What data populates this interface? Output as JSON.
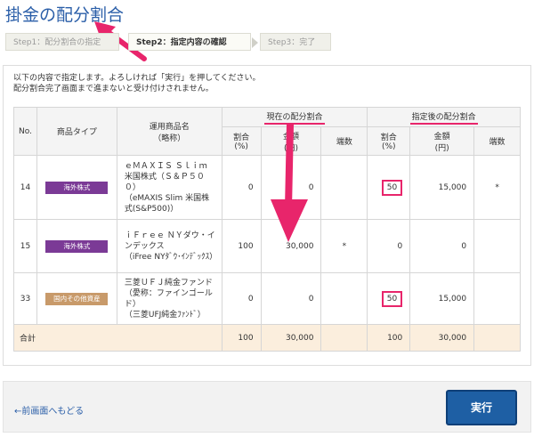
{
  "page": {
    "title": "掛金の配分割合"
  },
  "steps": [
    {
      "label": "Step1：配分割合の指定"
    },
    {
      "label": "Step2：指定内容の確認"
    },
    {
      "label": "Step3：完了"
    }
  ],
  "notice": {
    "line1": "以下の内容で指定します。よろしければ「実行」を押してください。",
    "line2": "配分割合完了画面まで進まないと受け付けされません。"
  },
  "table": {
    "headers": {
      "no": "No.",
      "type": "商品タイプ",
      "product": "運用商品名",
      "product_sub": "（略称）",
      "current_group": "現在の配分割合",
      "new_group": "指定後の配分割合",
      "ratio": "割合",
      "ratio_unit": "(%)",
      "amount": "金額",
      "amount_unit": "(円)",
      "fraction": "端数"
    },
    "rows": [
      {
        "no": "14",
        "type": "海外株式",
        "name1": "ｅＭＡＸＩＳ Ｓｌｉｍ 米国株式（Ｓ＆Ｐ５００）",
        "name2": "（eMAXIS Slim 米国株式(S&P500)）",
        "cur_ratio": "0",
        "cur_amount": "0",
        "cur_frac": "",
        "new_ratio": "50",
        "new_amount": "15,000",
        "new_frac": "*"
      },
      {
        "no": "15",
        "type": "海外株式",
        "name1": "ｉＦｒｅｅ ＮＹダウ・インデックス",
        "name2": "（iFree NYﾀﾞｳ･ｲﾝﾃﾞｯｸｽ）",
        "cur_ratio": "100",
        "cur_amount": "30,000",
        "cur_frac": "*",
        "new_ratio": "0",
        "new_amount": "0",
        "new_frac": ""
      },
      {
        "no": "33",
        "type": "国内その他資産",
        "name1": "三菱ＵＦＪ純金ファンド（愛称：ファインゴールド）",
        "name2": "（三菱UFJ純金ﾌｧﾝﾄﾞ）",
        "cur_ratio": "0",
        "cur_amount": "0",
        "cur_frac": "",
        "new_ratio": "50",
        "new_amount": "15,000",
        "new_frac": ""
      }
    ],
    "total": {
      "label": "合計",
      "cur_ratio": "100",
      "cur_amount": "30,000",
      "new_ratio": "100",
      "new_amount": "30,000"
    }
  },
  "footer": {
    "back_label": "←前画面へもどる",
    "exec_label": "実行"
  },
  "colors": {
    "accent_blue": "#1e5fa4",
    "highlight_pink": "#e8256b",
    "badge_foreign": "#7b3a96",
    "badge_domestic": "#c89a6a"
  }
}
